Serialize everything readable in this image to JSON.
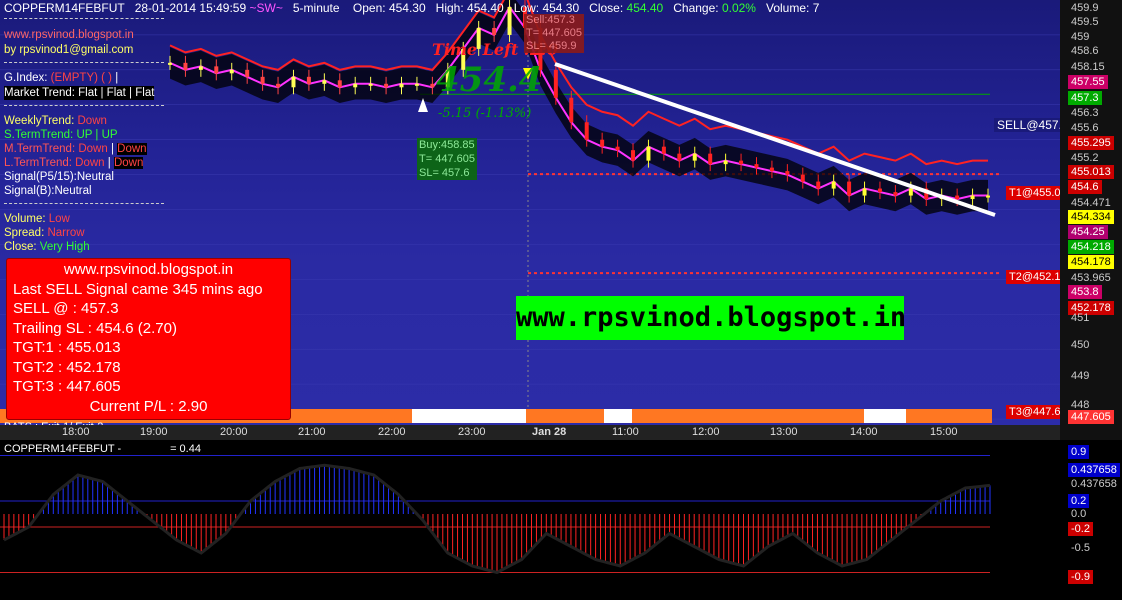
{
  "header": {
    "symbol": "COPPERM14FEBFUT",
    "datetime": "28-01-2014 15:49:59",
    "sw": "~SW~",
    "interval": "5-minute",
    "open_label": "Open:",
    "open": "454.30",
    "high_label": "High:",
    "high": "454.40",
    "low_label": "Low:",
    "low": "454.30",
    "close_label": "Close:",
    "close": "454.40",
    "change_label": "Change:",
    "change": "0.02%",
    "volume_label": "Volume:",
    "volume": "7"
  },
  "left_panel": {
    "blog": "www.rpsvinod.blogspot.in",
    "email": "by rpsvinod1@gmail.com",
    "gindex_label": "G.Index: ",
    "gindex_value": "(EMPTY) ( )",
    "gindex_tail": " |",
    "market_trend": "Market Trend: Flat | Flat | Flat",
    "weekly_label": "WeeklyTrend: ",
    "weekly_value": "Down",
    "sterm_label": "S.TermTrend: ",
    "sterm_value": "UP | UP",
    "mterm_label": "M.TermTrend: ",
    "mterm_value1": "Down",
    "mterm_value2": "Down",
    "lterm_label": "L.TermTrend: ",
    "lterm_value1": "Down",
    "lterm_value2": "Down",
    "signal_p": "Signal(P5/15):Neutral",
    "signal_b": "Signal(B):Neutral",
    "volume_label": "Volume: ",
    "volume_value": "Low",
    "spread_label": "Spread: ",
    "spread_value": "Narrow",
    "close_label": "Close: ",
    "close_value": "Very High",
    "bats": "BATS : Exit-1/ Exit-2"
  },
  "info_box": {
    "site": "www.rpsvinod.blogspot.in",
    "last_signal": "Last SELL Signal came 345 mins ago",
    "sell_at": "SELL @ : 457.3",
    "trailing_sl": "Trailing SL : 454.6 (2.70)",
    "tgt1": "TGT:1 : 455.013",
    "tgt2": "TGT:2 : 452.178",
    "tgt3": "TGT:3 : 447.605",
    "pl": "Current P/L : 2.90"
  },
  "banner": "www.rpsvinod.blogspot.in",
  "chart_annotations": {
    "time_left": "Time Left :2:0",
    "big_price": "454.4",
    "change_text": "-5.15   (-1.13%)",
    "buy_box": [
      "Buy:458.85",
      "T= 447.605",
      "SL= 457.6"
    ],
    "sell_box": [
      "Sell:457.3",
      "T= 447.605",
      "SL= 459.9"
    ],
    "sell_line_label": "SELL@457.3",
    "t1_label": "T1@455.013",
    "t2_label": "T2@452.178",
    "t3_label": "T3@447.605"
  },
  "price_axis": {
    "ticks": [
      "459.9",
      "459.5",
      "459",
      "458.6",
      "458.15",
      "457.55",
      "457.3",
      "456.3",
      "455.6",
      "455.295",
      "455.2",
      "455.013",
      "454.6",
      "454.471",
      "454.334",
      "454.25",
      "454.218",
      "454.178",
      "453.965",
      "453.8",
      "452.178",
      "451",
      "450",
      "449",
      "448",
      "447.605"
    ],
    "tag_colors": {
      "457.55": "#cc0066",
      "457.3": "#00aa00",
      "455.295": "#cc0000",
      "455.013": "#cc0000",
      "454.6": "#cc0000",
      "454.334": "#ffff00",
      "454.25": "#b0006f",
      "454.218": "#00aa00",
      "454.178": "#ffff00",
      "453.8": "#cc0066",
      "452.178": "#cc0000",
      "447.605": "#ff3333"
    }
  },
  "time_axis": [
    "18:00",
    "19:00",
    "20:00",
    "21:00",
    "22:00",
    "23:00",
    "Jan 28",
    "11:00",
    "12:00",
    "13:00",
    "14:00",
    "15:00"
  ],
  "oscillator": {
    "title": "COPPERM14FEBFUT -",
    "value_text": "= 0.44",
    "axis": [
      "0.9",
      "0.437658",
      "0.437658",
      "0.2",
      "0.0",
      "-0.2",
      "-0.5",
      "-0.9"
    ],
    "axis_colors": {
      "0.9": "#0000cc",
      "0.437658_a": "#0000cc",
      "0.2": "#0000cc",
      "-0.2": "#cc0000",
      "-0.9": "#cc0000"
    }
  },
  "chart_data": {
    "type": "candlestick",
    "ylim": [
      447.4,
      460.0
    ],
    "series": [
      {
        "name": "price",
        "values": [
          458.2,
          458.0,
          458.1,
          457.9,
          458.0,
          457.8,
          457.6,
          457.5,
          457.8,
          457.6,
          457.7,
          457.5,
          457.6,
          457.6,
          457.5,
          457.6,
          457.6,
          457.5,
          458.0,
          458.6,
          459.2,
          459.0,
          459.8,
          459.2,
          458.0,
          457.2,
          456.5,
          456.0,
          455.8,
          455.7,
          455.4,
          455.8,
          455.6,
          455.4,
          455.6,
          455.3,
          455.4,
          455.3,
          455.2,
          455.1,
          455.0,
          454.8,
          454.6,
          454.8,
          454.4,
          454.6,
          454.5,
          454.4,
          454.6,
          454.3,
          454.4,
          454.3,
          454.4,
          454.4
        ]
      }
    ],
    "oscillator_values": [
      -0.4,
      -0.2,
      0.3,
      0.6,
      0.5,
      0.2,
      -0.1,
      -0.4,
      -0.6,
      -0.3,
      0.2,
      0.5,
      0.7,
      0.75,
      0.7,
      0.6,
      0.3,
      -0.1,
      -0.6,
      -0.8,
      -0.9,
      -0.7,
      -0.3,
      -0.5,
      -0.7,
      -0.8,
      -0.6,
      -0.3,
      -0.5,
      -0.7,
      -0.8,
      -0.5,
      -0.3,
      -0.6,
      -0.8,
      -0.7,
      -0.4,
      -0.1,
      0.2,
      0.4,
      0.44
    ]
  }
}
